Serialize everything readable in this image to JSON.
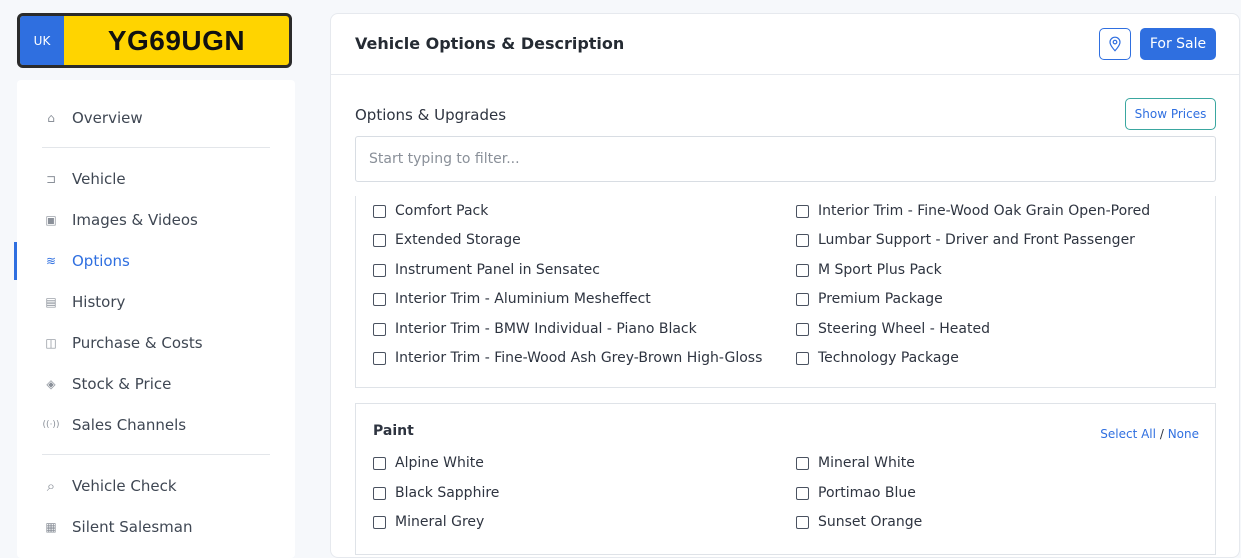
{
  "plate": {
    "country": "UK",
    "registration": "YG69UGN"
  },
  "sidebar": {
    "items": [
      {
        "label": "Overview",
        "icon": "home-icon",
        "glyph": "⌂",
        "active": false
      },
      {
        "label": "Vehicle",
        "icon": "car-icon",
        "glyph": "⊐",
        "active": false
      },
      {
        "label": "Images & Videos",
        "icon": "image-icon",
        "glyph": "▣",
        "active": false
      },
      {
        "label": "Options",
        "icon": "sliders-icon",
        "glyph": "≋",
        "active": true
      },
      {
        "label": "History",
        "icon": "history-icon",
        "glyph": "▤",
        "active": false
      },
      {
        "label": "Purchase & Costs",
        "icon": "receipt-icon",
        "glyph": "◫",
        "active": false
      },
      {
        "label": "Stock & Price",
        "icon": "box-icon",
        "glyph": "◈",
        "active": false
      },
      {
        "label": "Sales Channels",
        "icon": "broadcast-icon",
        "glyph": "((·))",
        "active": false
      },
      {
        "label": "Vehicle Check",
        "icon": "search-icon",
        "glyph": "⌕",
        "active": false
      },
      {
        "label": "Silent Salesman",
        "icon": "document-icon",
        "glyph": "▦",
        "active": false
      }
    ]
  },
  "main": {
    "title": "Vehicle Options & Description",
    "location_icon": "location-pin-icon",
    "status_button": "For Sale",
    "options_title": "Options & Upgrades",
    "show_prices": "Show Prices",
    "filter_placeholder": "Start typing to filter...",
    "options_left": [
      "Comfort Pack",
      "Extended Storage",
      "Instrument Panel in Sensatec",
      "Interior Trim - Aluminium Mesheffect",
      "Interior Trim - BMW Individual - Piano Black",
      "Interior Trim - Fine-Wood Ash Grey-Brown High-Gloss"
    ],
    "options_right": [
      "Interior Trim - Fine-Wood Oak Grain Open-Pored",
      "Lumbar Support - Driver and Front Passenger",
      "M Sport Plus Pack",
      "Premium Package",
      "Steering Wheel - Heated",
      "Technology Package"
    ],
    "paint": {
      "title": "Paint",
      "select_all": "Select All",
      "separator": "/",
      "none": "None",
      "left": [
        "Alpine White",
        "Black Sapphire",
        "Mineral Grey"
      ],
      "right": [
        "Mineral White",
        "Portimao Blue",
        "Sunset Orange"
      ]
    }
  },
  "colors": {
    "accent": "#2f6fe0",
    "plate_yellow": "#ffd400",
    "plate_band": "#2f6fe0"
  }
}
